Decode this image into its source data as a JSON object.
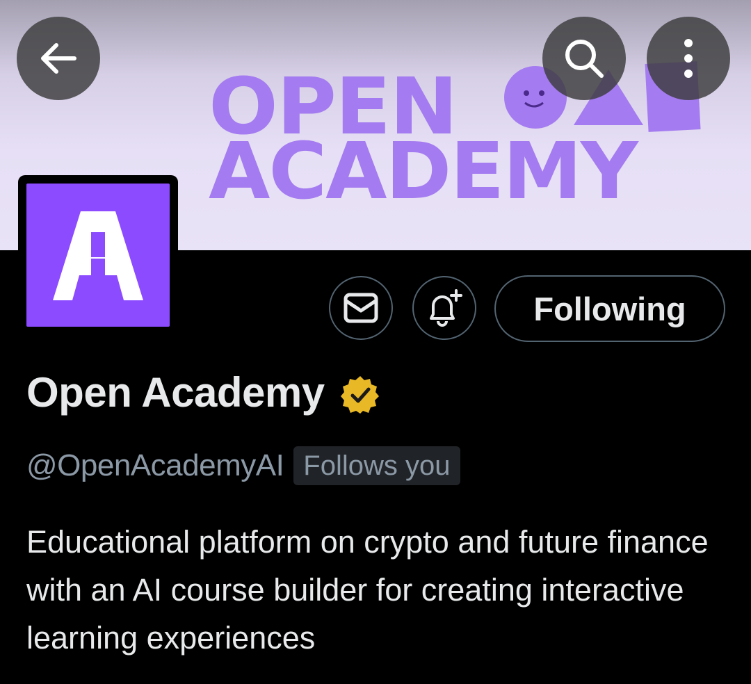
{
  "banner": {
    "line1": "OPEN",
    "line2": "ACADEMY"
  },
  "topbar": {
    "back_icon": "arrow-left-icon",
    "search_icon": "search-icon",
    "more_icon": "more-vertical-icon"
  },
  "profile": {
    "avatar_letter": "A",
    "name": "Open Academy",
    "verified_badge": "gold-verified-badge-icon",
    "handle": "@OpenAcademyAI",
    "follows_you": "Follows you",
    "bio": "Educational platform on crypto and future finance with an AI course builder for creating interactive learning experiences"
  },
  "actions": {
    "message_icon": "mail-icon",
    "notify_icon": "bell-plus-icon",
    "following_label": "Following"
  },
  "colors": {
    "brand_purple": "#8c4bff",
    "banner_text": "#a47bf0",
    "verified_gold": "#e8b826",
    "muted_text": "#8b98a5"
  }
}
